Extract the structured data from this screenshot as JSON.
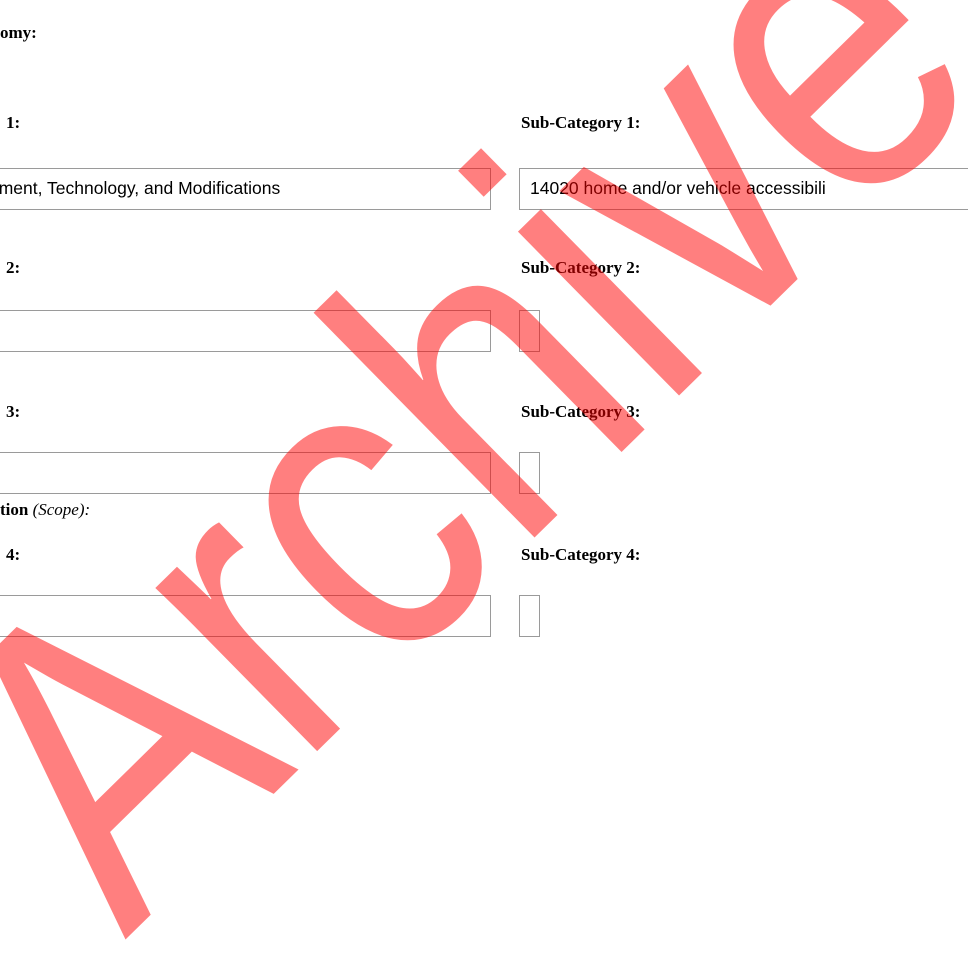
{
  "header": {
    "title": "omy:"
  },
  "rows": [
    {
      "category_label": "1:",
      "subcategory_label": "Sub-Category 1:",
      "category_value": "oment, Technology, and Modifications",
      "subcategory_value": "14020 home and/or vehicle accessibili"
    },
    {
      "category_label": "2:",
      "subcategory_label": "Sub-Category 2:",
      "category_value": "",
      "subcategory_value": ""
    },
    {
      "category_label": "3:",
      "subcategory_label": "Sub-Category 3:",
      "category_value": "",
      "subcategory_value": ""
    },
    {
      "category_label": "4:",
      "subcategory_label": "Sub-Category 4:",
      "category_value": "",
      "subcategory_value": ""
    }
  ],
  "scope_note": {
    "label": "tion",
    "hint": "(Scope):"
  },
  "watermark": {
    "text": "Archive",
    "color": "#ff0000"
  }
}
